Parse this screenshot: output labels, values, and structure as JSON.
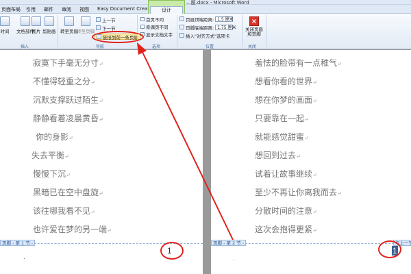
{
  "title": "...题.docx - Microsoft Word",
  "tabs": [
    "页面布局",
    "引用",
    "邮件",
    "审阅",
    "视图"
  ],
  "contextual_tab_group": "Easy Document Creator",
  "active_tab": "设计",
  "ribbon": {
    "group_insert": {
      "label": "插入",
      "buttons": [
        "时间",
        "文档部件",
        "图片",
        "剪贴画"
      ]
    },
    "group_nav": {
      "label": "导航",
      "goto_header": "转至页眉",
      "goto_footer": "转至页脚",
      "prev_section": "上一节",
      "next_section": "下一节",
      "link_to_previous": "链接到前一条页眉"
    },
    "group_options": {
      "label": "选项",
      "first_page_different": "首页不同",
      "odd_even_different": "奇偶页不同",
      "show_document_text": "显示文档文字",
      "first_page_checked": false,
      "odd_even_checked": false,
      "show_text_checked": true
    },
    "group_position": {
      "label": "位置",
      "header_top_label": "页眉顶端距离:",
      "header_top_value": "1.5 厘米",
      "footer_bottom_label": "页脚底端距离:",
      "footer_bottom_value": "1.75 厘米",
      "insert_align_tab": "插入\"对齐方式\"选项卡"
    },
    "group_close": {
      "label": "关闭",
      "close_button": "关闭页眉和页脚"
    }
  },
  "pages": {
    "left": {
      "lines": [
        "寂寞下手毫无分寸",
        "不懂得轻重之分",
        "沉默支撑跃过陌生",
        "静静看着凌晨黄昏",
        "你的身影",
        "失去平衡",
        "慢慢下沉",
        "黑暗已在空中盘旋",
        "该往哪我看不见",
        "也许爱在梦的另一端"
      ],
      "footer_tag": "页脚 - 第 1 节 -",
      "page_number": "1"
    },
    "right": {
      "lines": [
        "羞怯的脸带有一点稚气",
        "想看你看的世界",
        "想在你梦的画面",
        "只要靠在一起",
        "就能感觉甜蜜",
        "想回到过去",
        "试着让故事继续",
        "至少不再让你离我而去",
        "分散时间的注意",
        "这次会抱得更紧"
      ],
      "footer_tag": "页脚 - 第 2 节 -",
      "same_as_prev_tag": "与上一节",
      "page_number": "1"
    }
  },
  "colors": {
    "annotation_red": "#e0221b",
    "ribbon_bg": "#e3ebf6",
    "context_tab_green": "#c9eaa8"
  }
}
